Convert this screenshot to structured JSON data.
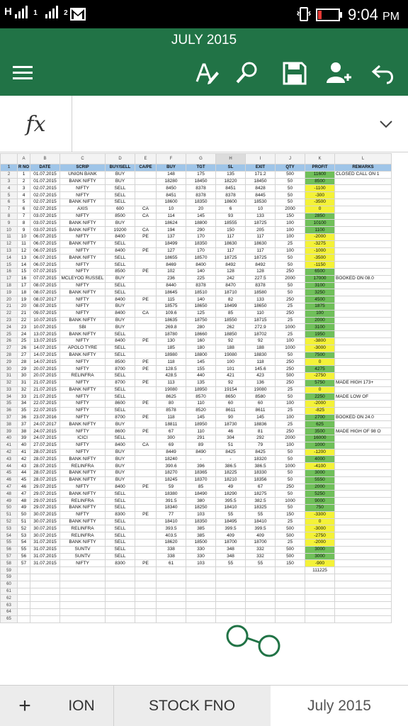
{
  "status": {
    "signal1": "H",
    "signal1_sub": "1",
    "signal2_sub": "2",
    "time": "9:04",
    "ampm": "PM"
  },
  "appbar": {
    "title": "JULY 2015",
    "icons": [
      "menu-icon",
      "text-format-icon",
      "search-icon",
      "save-icon",
      "share-user-icon",
      "undo-icon"
    ]
  },
  "formula": {
    "fx": "fx",
    "value": ""
  },
  "grid": {
    "col_letters": [
      "A",
      "B",
      "C",
      "D",
      "E",
      "F",
      "G",
      "H",
      "I",
      "J",
      "K",
      "L"
    ],
    "headers": [
      "R NO",
      "DATE",
      "SCRIP",
      "BUY/SELL",
      "CA/PE",
      "BUY",
      "TGT",
      "SL",
      "EXIT",
      "QTY",
      "PROFIT",
      "REMARKS"
    ],
    "rows": [
      [
        "1",
        "01.07.2015",
        "UNION BANK",
        "BUY",
        "",
        "148",
        "175",
        "135",
        "171.2",
        "500",
        "11600",
        "CLOSED CALL ON 1"
      ],
      [
        "2",
        "01.07.2015",
        "BANK NIFTY",
        "BUY",
        "",
        "18280",
        "18450",
        "18220",
        "18450",
        "50",
        "8500",
        ""
      ],
      [
        "3",
        "02.07.2015",
        "NIFTY",
        "SELL",
        "",
        "8450",
        "8378",
        "8451",
        "8428",
        "50",
        "-1100",
        ""
      ],
      [
        "4",
        "02.07.2015",
        "NIFTY",
        "SELL",
        "",
        "8451",
        "8378",
        "8378",
        "8445",
        "50",
        "-300",
        ""
      ],
      [
        "5",
        "02.07.2015",
        "BANK NIFTY",
        "SELL",
        "",
        "18600",
        "18350",
        "18600",
        "18530",
        "50",
        "-3500",
        ""
      ],
      [
        "6",
        "02.07.2015",
        "AXIS",
        "600",
        "CA",
        "10",
        "20",
        "6",
        "10",
        "2000",
        "0",
        ""
      ],
      [
        "7",
        "03.07.2015",
        "NIFTY",
        "8500",
        "CA",
        "114",
        "145",
        "93",
        "133",
        "150",
        "2850",
        ""
      ],
      [
        "8",
        "03.07.2015",
        "BANK NIFTY",
        "BUY",
        "",
        "18624",
        "18800",
        "18555",
        "18725",
        "100",
        "10100",
        ""
      ],
      [
        "9",
        "03.07.2015",
        "BANK NIFTY",
        "19200",
        "CA",
        "194",
        "290",
        "150",
        "205",
        "100",
        "1100",
        ""
      ],
      [
        "10",
        "06.07.2015",
        "NIFTY",
        "8400",
        "PE",
        "137",
        "170",
        "117",
        "117",
        "100",
        "-2000",
        ""
      ],
      [
        "11",
        "06.07.2015",
        "BANK NIFTY",
        "SELL",
        "",
        "18499",
        "18350",
        "18630",
        "18630",
        "25",
        "-3275",
        ""
      ],
      [
        "12",
        "06.07.2015",
        "NIFTY",
        "8400",
        "PE",
        "127",
        "170",
        "117",
        "117",
        "100",
        "-1000",
        ""
      ],
      [
        "13",
        "06.07.2015",
        "BANK NIFTY",
        "SELL",
        "",
        "18655",
        "18570",
        "18725",
        "18725",
        "50",
        "-3500",
        ""
      ],
      [
        "14",
        "06.07.2015",
        "NIFTY",
        "SELL",
        "",
        "8469",
        "8400",
        "8492",
        "8492",
        "50",
        "-1150",
        ""
      ],
      [
        "15",
        "07.07.2015",
        "NIFTY",
        "8500",
        "PE",
        "102",
        "140",
        "128",
        "128",
        "250",
        "6500",
        ""
      ],
      [
        "16",
        "07.07.2015",
        "MCLEYOD RUSSEL",
        "BUY",
        "",
        "236",
        "225",
        "242",
        "227.5",
        "2000",
        "17000",
        "BOOKED ON 08.0"
      ],
      [
        "17",
        "08.07.2015",
        "NIFTY",
        "SELL",
        "",
        "8440",
        "8378",
        "8470",
        "8378",
        "50",
        "3100",
        ""
      ],
      [
        "18",
        "08.07.2015",
        "BANK NIFTY",
        "SELL",
        "",
        "18645",
        "18510",
        "18710",
        "18580",
        "50",
        "3250",
        ""
      ],
      [
        "19",
        "08.07.2017",
        "NIFTY",
        "8400",
        "PE",
        "115",
        "140",
        "82",
        "133",
        "250",
        "4500",
        ""
      ],
      [
        "20",
        "08.07.2015",
        "NIFTY",
        "BUY",
        "",
        "18575",
        "18650",
        "18499",
        "18650",
        "25",
        "1875",
        ""
      ],
      [
        "21",
        "09.07.2015",
        "NIFTY",
        "8400",
        "CA",
        "109.6",
        "125",
        "85",
        "110",
        "250",
        "100",
        ""
      ],
      [
        "22",
        "10.07.2015",
        "BANK NIFTY",
        "BUY",
        "",
        "18635",
        "18750",
        "18550",
        "18715",
        "25",
        "2000",
        ""
      ],
      [
        "23",
        "10.07.2015",
        "SBI",
        "BUY",
        "",
        "269.8",
        "280",
        "262",
        "272.9",
        "1000",
        "3100",
        ""
      ],
      [
        "24",
        "13.07.2015",
        "BANK NIFTY",
        "SELL",
        "",
        "18780",
        "18660",
        "18850",
        "18702",
        "25",
        "1950",
        ""
      ],
      [
        "25",
        "13.07.2015",
        "NIFTY",
        "8400",
        "PE",
        "130",
        "160",
        "92",
        "92",
        "100",
        "-3800",
        ""
      ],
      [
        "26",
        "14.07.2015",
        "APOLO TYRE",
        "SELL",
        "",
        "185",
        "180",
        "188",
        "188",
        "1000",
        "-3000",
        ""
      ],
      [
        "27",
        "14.07.2015",
        "BANK NIFTY",
        "SELL",
        "",
        "18980",
        "18800",
        "19080",
        "18830",
        "50",
        "7500",
        ""
      ],
      [
        "28",
        "14.07.2015",
        "NIFTY",
        "8500",
        "PE",
        "118",
        "145",
        "100",
        "118",
        "250",
        "0",
        ""
      ],
      [
        "29",
        "20.07.2015",
        "NIFTY",
        "8700",
        "PE",
        "128.5",
        "155",
        "101",
        "145.6",
        "250",
        "4275",
        ""
      ],
      [
        "30",
        "20.07.2015",
        "RELINFRA",
        "SELL",
        "",
        "428.5",
        "440",
        "421",
        "423",
        "500",
        "-2750",
        ""
      ],
      [
        "31",
        "21.07.2015",
        "NIFTY",
        "8700",
        "PE",
        "113",
        "135",
        "92",
        "136",
        "250",
        "5750",
        "MADE HIGH 173+"
      ],
      [
        "32",
        "21.07.2015",
        "BANK NIFTY",
        "SELL",
        "",
        "19080",
        "18950",
        "19154",
        "19080",
        "25",
        "0",
        ""
      ],
      [
        "33",
        "21.07.2015",
        "NIFTY",
        "SELL",
        "",
        "8625",
        "8570",
        "8650",
        "8580",
        "50",
        "2250",
        "MADE LOW OF"
      ],
      [
        "34",
        "22.07.2015",
        "NIFTY",
        "8600",
        "PE",
        "80",
        "110",
        "60",
        "60",
        "100",
        "-2000",
        ""
      ],
      [
        "35",
        "22.07.2015",
        "NIFTY",
        "SELL",
        "",
        "8578",
        "8520",
        "8611",
        "8611",
        "25",
        "-825",
        ""
      ],
      [
        "36",
        "23.07.2016",
        "NIFTY",
        "8700",
        "PE",
        "118",
        "145",
        "90",
        "145",
        "100",
        "2700",
        "BOOKED ON 24.0"
      ],
      [
        "37",
        "24.07.2017",
        "BANK NIFTY",
        "BUY",
        "",
        "18811",
        "18950",
        "18730",
        "18836",
        "25",
        "625",
        ""
      ],
      [
        "38",
        "24.07.2015",
        "NIFTY",
        "8600",
        "PE",
        "67",
        "110",
        "46",
        "81",
        "250",
        "3500",
        "MADE HIGH OF 98 O"
      ],
      [
        "39",
        "24.07.2015",
        "ICICI",
        "SELL",
        "",
        "300",
        "291",
        "304",
        "292",
        "2000",
        "16000",
        ""
      ],
      [
        "40",
        "27.07.2015",
        "NIFTY",
        "8400",
        "CA",
        "69",
        "89",
        "51",
        "79",
        "100",
        "1000",
        ""
      ],
      [
        "41",
        "28.07.2015",
        "NIFTY",
        "BUY",
        "",
        "8449",
        "8490",
        "8425",
        "8425",
        "50",
        "-1200",
        ""
      ],
      [
        "42",
        "28.07.2015",
        "BANK NIFTY",
        "BUY",
        "",
        "18240",
        "-",
        "-",
        "18320",
        "50",
        "4000",
        ""
      ],
      [
        "43",
        "28.07.2015",
        "RELINFRA",
        "BUY",
        "",
        "390.6",
        "396",
        "386.5",
        "386.5",
        "1000",
        "-4100",
        ""
      ],
      [
        "44",
        "28.07.2015",
        "BANK NIFTY",
        "BUY",
        "",
        "18270",
        "18365",
        "18225",
        "18330",
        "50",
        "3000",
        ""
      ],
      [
        "45",
        "28.07.2015",
        "BANK NIFTY",
        "BUY",
        "",
        "18245",
        "18370",
        "18210",
        "18356",
        "50",
        "5550",
        ""
      ],
      [
        "46",
        "29.07.2015",
        "NIFTY",
        "8400",
        "PE",
        "59",
        "85",
        "49",
        "67",
        "250",
        "2000",
        ""
      ],
      [
        "47",
        "29.07.2015",
        "BANK NIFTY",
        "SELL",
        "",
        "18380",
        "18490",
        "18290",
        "18275",
        "50",
        "5250",
        ""
      ],
      [
        "48",
        "29.07.2015",
        "RELINFRA",
        "SELL",
        "",
        "391.5",
        "380",
        "395.5",
        "382.5",
        "1000",
        "9000",
        ""
      ],
      [
        "49",
        "29.07.2015",
        "BANK NIFTY",
        "SELL",
        "",
        "18340",
        "18250",
        "18410",
        "18325",
        "50",
        "750",
        ""
      ],
      [
        "50",
        "30.07.2015",
        "NIFTY",
        "8300",
        "PE",
        "77",
        "103",
        "55",
        "55",
        "150",
        "-3300",
        ""
      ],
      [
        "51",
        "30.07.2015",
        "BANK NIFTY",
        "SELL",
        "",
        "18410",
        "18350",
        "18495",
        "18410",
        "25",
        "0",
        ""
      ],
      [
        "52",
        "30.07.2015",
        "RELINFRA",
        "SELL",
        "",
        "393.5",
        "385",
        "399.5",
        "399.5",
        "500",
        "-3000",
        ""
      ],
      [
        "53",
        "30.07.2015",
        "RELINFRA",
        "SELL",
        "",
        "403.5",
        "385",
        "409",
        "409",
        "500",
        "-2750",
        ""
      ],
      [
        "54",
        "31.07.2015",
        "BANK NIFTY",
        "SELL",
        "",
        "18620",
        "18500",
        "18700",
        "18700",
        "25",
        "-2000",
        ""
      ],
      [
        "55",
        "31.07.2015",
        "SUNTV",
        "SELL",
        "",
        "338",
        "330",
        "348",
        "332",
        "500",
        "3000",
        ""
      ],
      [
        "56",
        "31.07.2015",
        "SUNTV",
        "SELL",
        "",
        "338",
        "330",
        "348",
        "332",
        "500",
        "3000",
        ""
      ],
      [
        "57",
        "31.07.2015",
        "NIFTY",
        "8300",
        "PE",
        "61",
        "103",
        "55",
        "55",
        "150",
        "-900",
        ""
      ]
    ],
    "total": "111225",
    "row_numbers_extra": [
      "59",
      "60",
      "61",
      "62",
      "63",
      "64",
      "65"
    ],
    "colors": {
      "profit_high": "#70c05a",
      "profit_low": "#f4f238",
      "header": "#9fc5e8",
      "excel_green": "#217346"
    }
  },
  "tabs": {
    "add": "+",
    "items": [
      "ION",
      "STOCK FNO",
      "July 2015"
    ],
    "active_index": 2
  }
}
